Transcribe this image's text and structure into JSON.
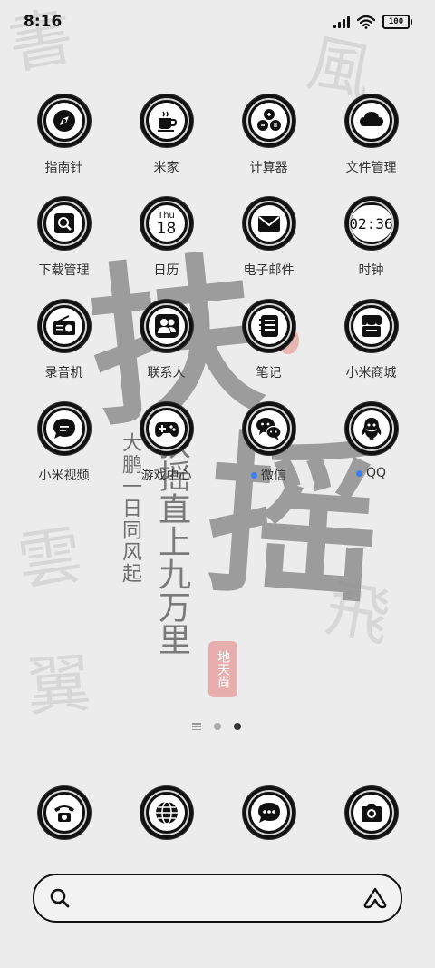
{
  "status_bar": {
    "time": "8:16",
    "battery": "100"
  },
  "wallpaper": {
    "big_char_1": "扶",
    "big_char_2": "摇",
    "poem_left": "大鹏一日同风起",
    "poem_right": "扶摇直上九万里",
    "seal_text": "地天尚"
  },
  "apps": [
    {
      "label": "指南针",
      "icon": "compass-icon"
    },
    {
      "label": "米家",
      "icon": "cup-icon"
    },
    {
      "label": "计算器",
      "icon": "calculator-icon"
    },
    {
      "label": "文件管理",
      "icon": "cloud-folder-icon"
    },
    {
      "label": "下载管理",
      "icon": "download-search-icon"
    },
    {
      "label": "日历",
      "icon": "calendar-icon",
      "day": "Thu",
      "date": "18"
    },
    {
      "label": "电子邮件",
      "icon": "mail-icon"
    },
    {
      "label": "时钟",
      "icon": "clock-icon",
      "time": "02:36"
    },
    {
      "label": "录音机",
      "icon": "radio-icon"
    },
    {
      "label": "联系人",
      "icon": "contacts-icon"
    },
    {
      "label": "笔记",
      "icon": "notes-icon"
    },
    {
      "label": "小米商城",
      "icon": "store-icon"
    },
    {
      "label": "小米视频",
      "icon": "video-chat-icon"
    },
    {
      "label": "游戏中心",
      "icon": "gamepad-icon"
    },
    {
      "label": "微信",
      "icon": "wechat-icon",
      "new_dot": true
    },
    {
      "label": "QQ",
      "icon": "qq-icon",
      "new_dot": true
    }
  ],
  "dock": [
    {
      "name": "phone",
      "icon": "phone-icon"
    },
    {
      "name": "browser",
      "icon": "globe-icon"
    },
    {
      "name": "messages",
      "icon": "message-icon"
    },
    {
      "name": "camera",
      "icon": "camera-icon"
    }
  ],
  "pager": {
    "pages": 2,
    "active": 2
  },
  "colors": {
    "accent_dot": "#3b7ff2",
    "ring": "#111111",
    "seal": "#e7a8a8"
  }
}
